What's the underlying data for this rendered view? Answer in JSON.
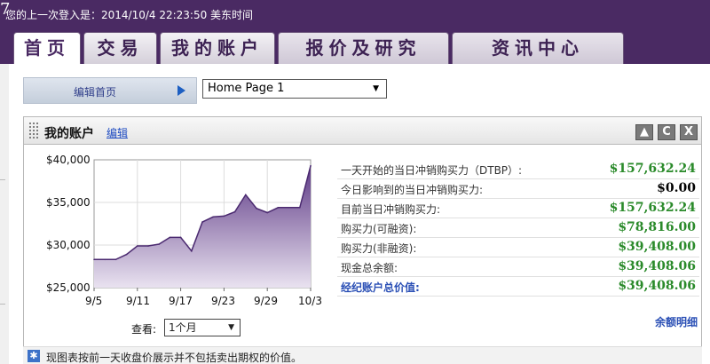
{
  "header": {
    "last_login": "您的上一次登入是：2014/10/4 22:23:50 美东时间"
  },
  "tabs": [
    {
      "label": "首页",
      "active": true
    },
    {
      "label": "交易",
      "active": false
    },
    {
      "label": "我的账户",
      "active": false
    },
    {
      "label": "报价及研究",
      "active": false
    },
    {
      "label": "资讯中心",
      "active": false
    }
  ],
  "homebar": {
    "edit_label": "编辑首页",
    "page_select": "Home Page 1"
  },
  "panel": {
    "title": "我的账户",
    "edit_link": "编辑",
    "controls": [
      "▲",
      "C",
      "X"
    ]
  },
  "chart_data": {
    "type": "area",
    "x_tick_labels": [
      "9/5",
      "9/11",
      "9/17",
      "9/23",
      "9/29",
      "10/3"
    ],
    "y_tick_labels": [
      "$40,000",
      "$35,000",
      "$30,000",
      "$25,000"
    ],
    "ylim": [
      25000,
      40000
    ],
    "series": [
      {
        "values": [
          28300,
          28300,
          28300,
          28900,
          29900,
          29900,
          30100,
          30900,
          30900,
          29300,
          32700,
          33300,
          33400,
          33900,
          35900,
          34300,
          33800,
          34400,
          34400,
          34400,
          39300
        ]
      }
    ],
    "fill_top": "#5e3a86",
    "fill_bottom": "#e9e2f0",
    "grid": true
  },
  "view": {
    "label": "查看:",
    "selected": "1个月"
  },
  "balances": [
    {
      "label": "一天开始的当日冲销购买力（DTBP）:",
      "value": "$157,632.24",
      "color": "green"
    },
    {
      "label": "今日影响到的当日冲销购买力:",
      "value": "$0.00",
      "color": "black"
    },
    {
      "label": "目前当日冲销购买力:",
      "value": "$157,632.24",
      "color": "green"
    },
    {
      "label": "购买力(可融资):",
      "value": "$78,816.00",
      "color": "green"
    },
    {
      "label": "购买力(非融资):",
      "value": "$39,408.00",
      "color": "green"
    },
    {
      "label": "现金总余额:",
      "value": "$39,408.06",
      "color": "green"
    },
    {
      "label": "经纪账户总价值:",
      "value": "$39,408.06",
      "color": "green"
    }
  ],
  "detail_link": "余额明细",
  "footnote": "现图表按前一天收盘价展示并不包括卖出期权的价值。"
}
